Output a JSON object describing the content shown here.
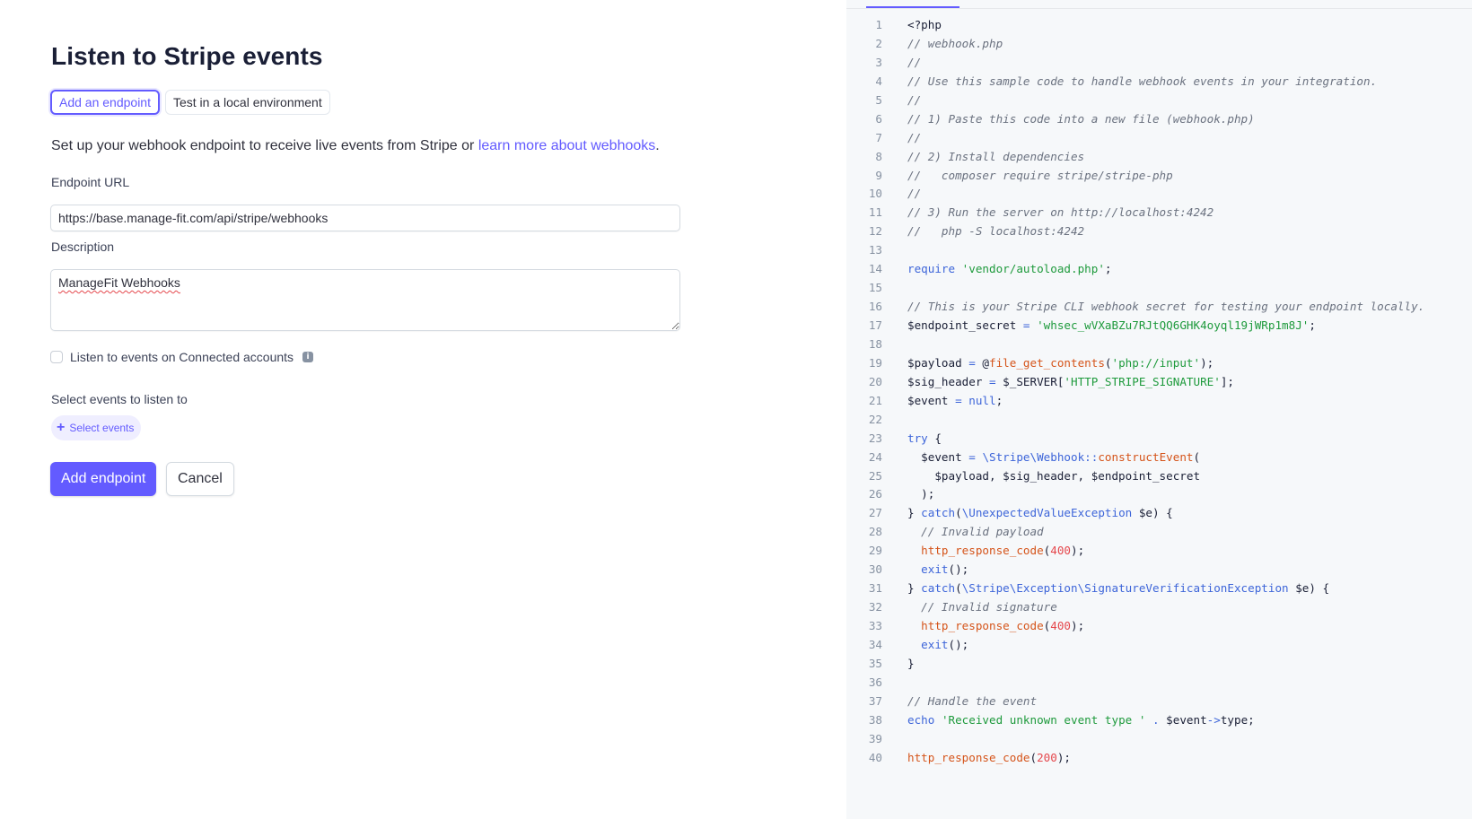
{
  "form": {
    "title": "Listen to Stripe events",
    "tabs": [
      {
        "label": "Add an endpoint",
        "active": true
      },
      {
        "label": "Test in a local environment",
        "active": false
      }
    ],
    "intro_text": "Set up your webhook endpoint to receive live events from Stripe or ",
    "intro_link": "learn more about webhooks",
    "intro_end": ".",
    "endpoint_url_label": "Endpoint URL",
    "endpoint_url_value": "https://base.manage-fit.com/api/stripe/webhooks",
    "description_label": "Description",
    "description_value": "ManageFit Webhooks",
    "connected_accounts_label": "Listen to events on Connected accounts",
    "connected_accounts_checked": false,
    "info_icon": "info-icon",
    "select_events_label": "Select events to listen to",
    "select_events_button": "Select events",
    "add_endpoint_button": "Add endpoint",
    "cancel_button": "Cancel",
    "accent_color": "#635bff"
  },
  "code": {
    "language": "php",
    "lines": [
      [
        [
          "pl",
          "<?php"
        ]
      ],
      [
        [
          "cm",
          "// webhook.php"
        ]
      ],
      [
        [
          "cm",
          "//"
        ]
      ],
      [
        [
          "cm",
          "// Use this sample code to handle webhook events in your integration."
        ]
      ],
      [
        [
          "cm",
          "//"
        ]
      ],
      [
        [
          "cm",
          "// 1) Paste this code into a new file (webhook.php)"
        ]
      ],
      [
        [
          "cm",
          "//"
        ]
      ],
      [
        [
          "cm",
          "// 2) Install dependencies"
        ]
      ],
      [
        [
          "cm",
          "//   composer require stripe/stripe-php"
        ]
      ],
      [
        [
          "cm",
          "//"
        ]
      ],
      [
        [
          "cm",
          "// 3) Run the server on http://localhost:4242"
        ]
      ],
      [
        [
          "cm",
          "//   php -S localhost:4242"
        ]
      ],
      [],
      [
        [
          "kw",
          "require"
        ],
        [
          "pl",
          " "
        ],
        [
          "str",
          "'vendor/autoload.php'"
        ],
        [
          "pl",
          ";"
        ]
      ],
      [],
      [
        [
          "cm",
          "// This is your Stripe CLI webhook secret for testing your endpoint locally."
        ]
      ],
      [
        [
          "pl",
          "$endpoint_secret "
        ],
        [
          "op",
          "="
        ],
        [
          "pl",
          " "
        ],
        [
          "str",
          "'whsec_wVXaBZu7RJtQQ6GHK4oyql19jWRp1m8J'"
        ],
        [
          "pl",
          ";"
        ]
      ],
      [],
      [
        [
          "pl",
          "$payload "
        ],
        [
          "op",
          "="
        ],
        [
          "pl",
          " @"
        ],
        [
          "fn",
          "file_get_contents"
        ],
        [
          "pl",
          "("
        ],
        [
          "str",
          "'php://input'"
        ],
        [
          "pl",
          ");"
        ]
      ],
      [
        [
          "pl",
          "$sig_header "
        ],
        [
          "op",
          "="
        ],
        [
          "pl",
          " $_SERVER["
        ],
        [
          "str",
          "'HTTP_STRIPE_SIGNATURE'"
        ],
        [
          "pl",
          "];"
        ]
      ],
      [
        [
          "pl",
          "$event "
        ],
        [
          "op",
          "="
        ],
        [
          "pl",
          " "
        ],
        [
          "kw",
          "null"
        ],
        [
          "pl",
          ";"
        ]
      ],
      [],
      [
        [
          "kw",
          "try"
        ],
        [
          "pl",
          " {"
        ]
      ],
      [
        [
          "pl",
          "  $event "
        ],
        [
          "op",
          "="
        ],
        [
          "pl",
          " "
        ],
        [
          "ns",
          "\\Stripe\\Webhook::"
        ],
        [
          "fn",
          "constructEvent"
        ],
        [
          "pl",
          "("
        ]
      ],
      [
        [
          "pl",
          "    $payload, $sig_header, $endpoint_secret"
        ]
      ],
      [
        [
          "pl",
          "  );"
        ]
      ],
      [
        [
          "pl",
          "} "
        ],
        [
          "kw",
          "catch"
        ],
        [
          "pl",
          "("
        ],
        [
          "ns",
          "\\UnexpectedValueException"
        ],
        [
          "pl",
          " $e) {"
        ]
      ],
      [
        [
          "cm",
          "  // Invalid payload"
        ]
      ],
      [
        [
          "pl",
          "  "
        ],
        [
          "fn",
          "http_response_code"
        ],
        [
          "pl",
          "("
        ],
        [
          "num",
          "400"
        ],
        [
          "pl",
          ");"
        ]
      ],
      [
        [
          "pl",
          "  "
        ],
        [
          "kw",
          "exit"
        ],
        [
          "pl",
          "();"
        ]
      ],
      [
        [
          "pl",
          "} "
        ],
        [
          "kw",
          "catch"
        ],
        [
          "pl",
          "("
        ],
        [
          "ns",
          "\\Stripe\\Exception\\SignatureVerificationException"
        ],
        [
          "pl",
          " $e) {"
        ]
      ],
      [
        [
          "cm",
          "  // Invalid signature"
        ]
      ],
      [
        [
          "pl",
          "  "
        ],
        [
          "fn",
          "http_response_code"
        ],
        [
          "pl",
          "("
        ],
        [
          "num",
          "400"
        ],
        [
          "pl",
          ");"
        ]
      ],
      [
        [
          "pl",
          "  "
        ],
        [
          "kw",
          "exit"
        ],
        [
          "pl",
          "();"
        ]
      ],
      [
        [
          "pl",
          "}"
        ]
      ],
      [],
      [
        [
          "cm",
          "// Handle the event"
        ]
      ],
      [
        [
          "kw",
          "echo"
        ],
        [
          "pl",
          " "
        ],
        [
          "str",
          "'Received unknown event type '"
        ],
        [
          "pl",
          " "
        ],
        [
          "op",
          "."
        ],
        [
          "pl",
          " $event"
        ],
        [
          "op",
          "->"
        ],
        [
          "pl",
          "type;"
        ]
      ],
      [],
      [
        [
          "fn",
          "http_response_code"
        ],
        [
          "pl",
          "("
        ],
        [
          "num",
          "200"
        ],
        [
          "pl",
          ");"
        ]
      ]
    ]
  }
}
